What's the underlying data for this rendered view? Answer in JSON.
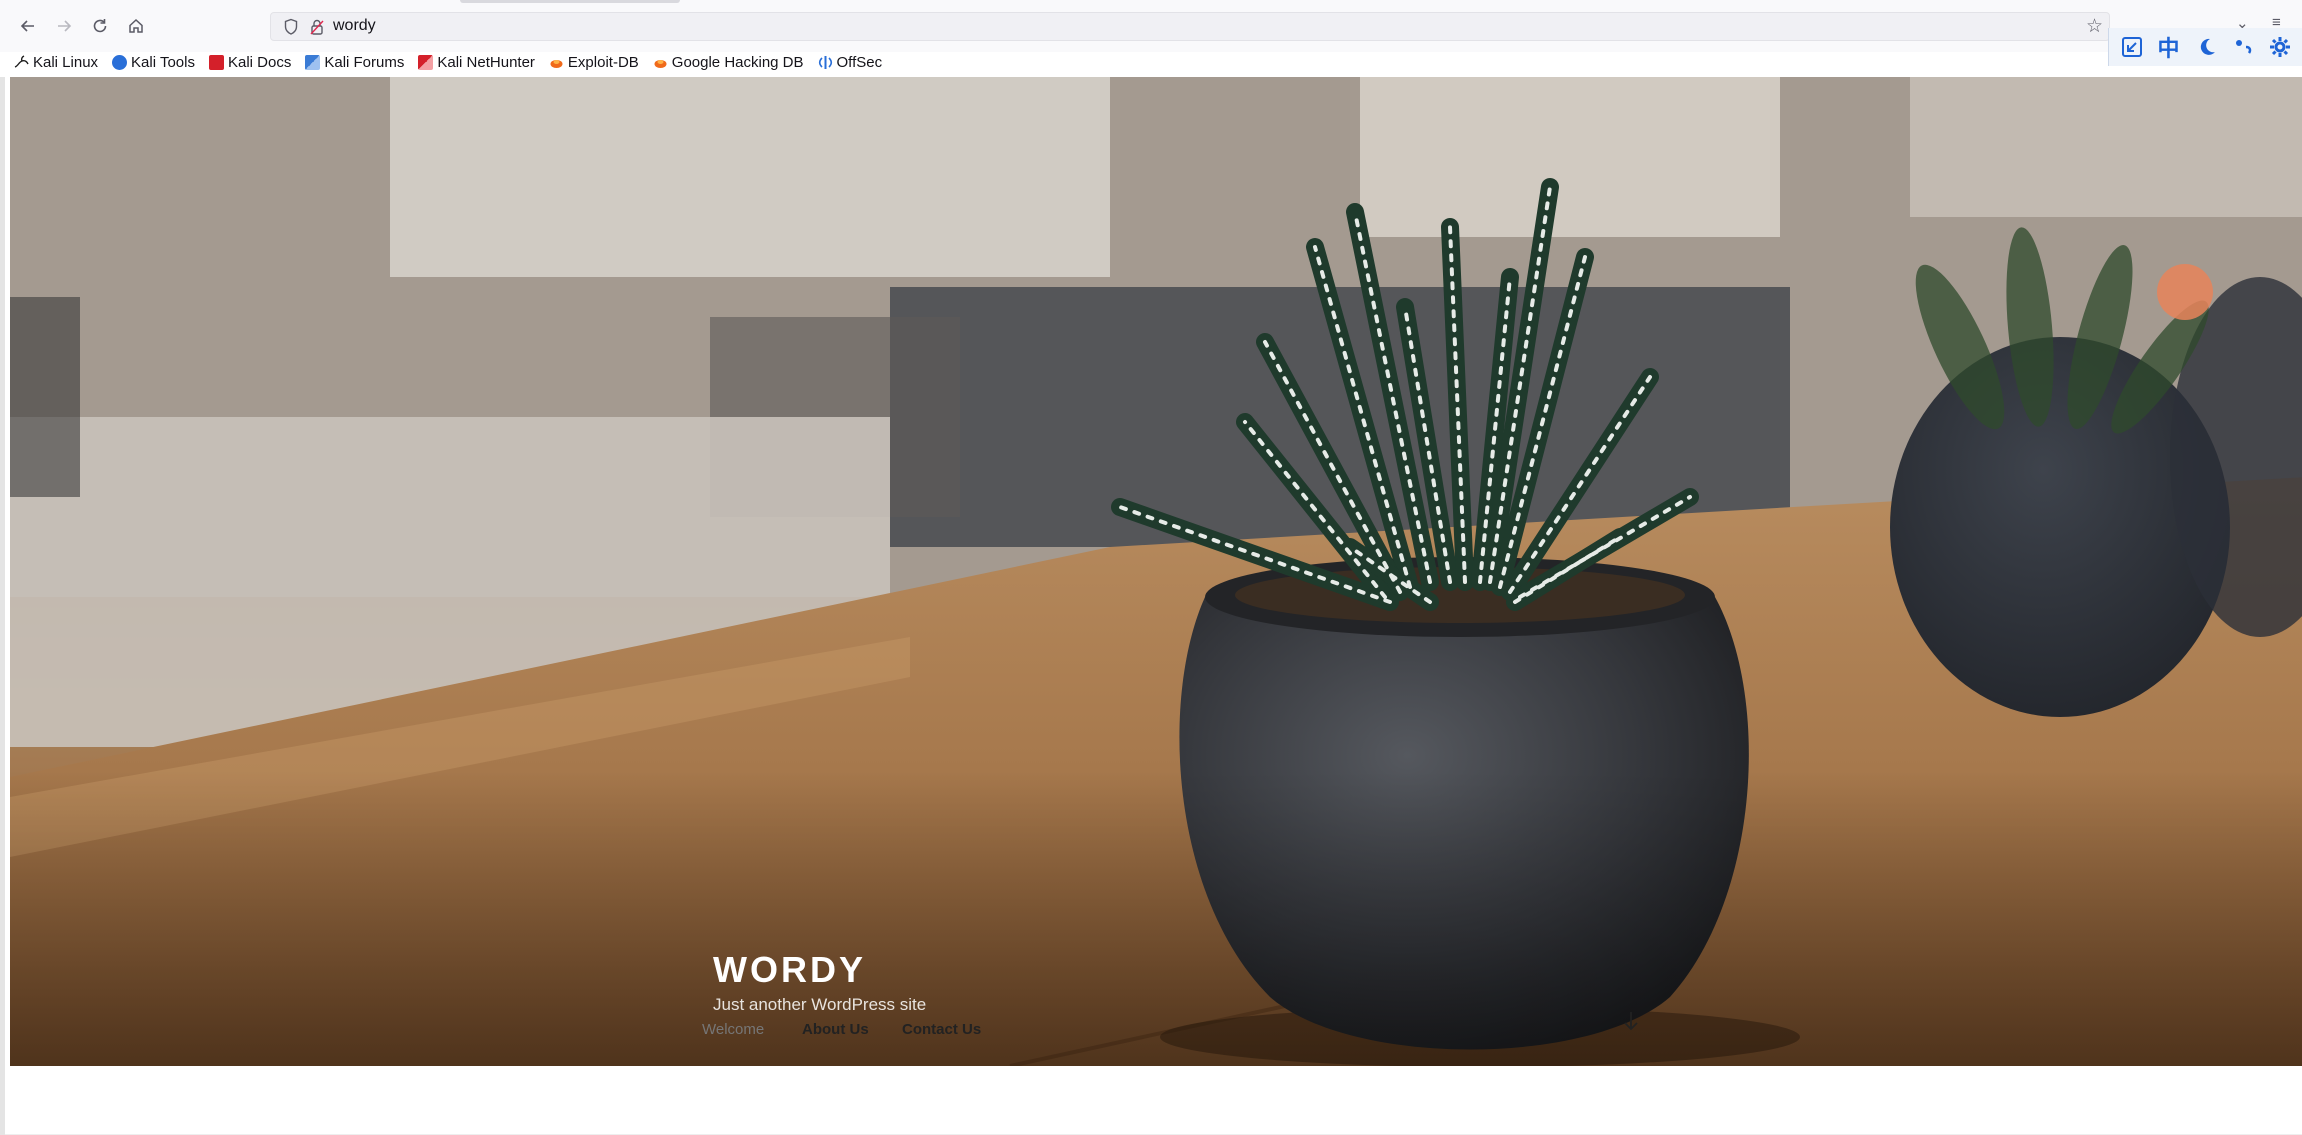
{
  "browser": {
    "url": "wordy",
    "nav_icons": [
      "back-icon",
      "forward-icon",
      "reload-icon",
      "home-icon"
    ],
    "bookmarks": [
      {
        "label": "Kali Linux",
        "icon": "kali-dragon-icon",
        "color": "#1c1c1c"
      },
      {
        "label": "Kali Tools",
        "icon": "kali-tools-icon",
        "color": "#2a6fd8"
      },
      {
        "label": "Kali Docs",
        "icon": "kali-docs-icon",
        "color": "#d4202a"
      },
      {
        "label": "Kali Forums",
        "icon": "kali-forums-icon",
        "color": "#3a7bd5"
      },
      {
        "label": "Kali NetHunter",
        "icon": "kali-nethunter-icon",
        "color": "#d4202a"
      },
      {
        "label": "Exploit-DB",
        "icon": "exploit-db-icon",
        "color": "#f06a1a"
      },
      {
        "label": "Google Hacking DB",
        "icon": "ghdb-icon",
        "color": "#f06a1a"
      },
      {
        "label": "OffSec",
        "icon": "offsec-icon",
        "color": "#2a6fd8"
      }
    ],
    "extension_icons": [
      "screenshot-icon",
      "translate-icon",
      "dark-mode-icon",
      "link-icon",
      "settings-icon"
    ],
    "extension_glyphs": {
      "translate": "中"
    }
  },
  "site": {
    "title": "WORDY",
    "description": "Just another WordPress site",
    "menu": [
      {
        "label": "Welcome",
        "current": true
      },
      {
        "label": "About Us",
        "current": false
      },
      {
        "label": "Contact Us",
        "current": false
      }
    ]
  },
  "colors": {
    "accent": "#1e64d6",
    "nav_current": "#767676",
    "nav_text": "#222222"
  }
}
